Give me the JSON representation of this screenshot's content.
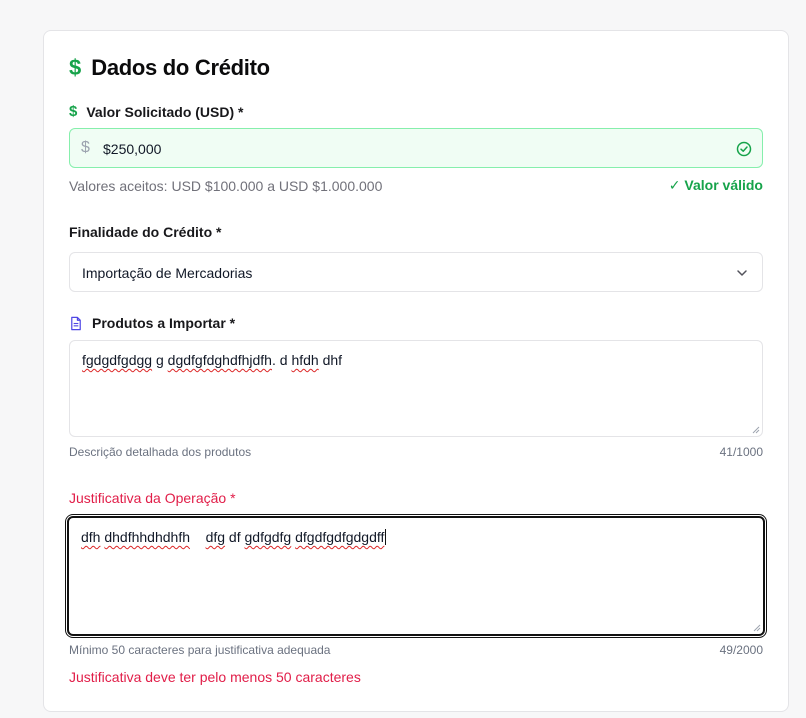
{
  "section": {
    "title": "Dados do Crédito"
  },
  "amount": {
    "label": "Valor Solicitado (USD) *",
    "prefix": "$",
    "value": "$250,000",
    "range_hint": "Valores aceitos: USD $100.000 a USD $1.000.000",
    "valid_message": "✓ Valor válido"
  },
  "purpose": {
    "label": "Finalidade do Crédito *",
    "selected": "Importação de Mercadorias"
  },
  "products": {
    "label": "Produtos a Importar *",
    "value": "fgdgdfgdgg g dgdfgfdghdfhjdfh. d hfdh dhf",
    "hint": "Descrição detalhada dos produtos",
    "count": "41/1000"
  },
  "justification": {
    "label": "Justificativa da Operação *",
    "value": "dfh dhdfhhdhdhfh    dfg df gdfgdfg dfgdfgdfgdgdff",
    "hint": "Mínimo 50 caracteres para justificativa adequada",
    "count": "49/2000",
    "error": "Justificativa deve ter pelo menos 50 caracteres"
  },
  "colors": {
    "accent_green": "#16a34a",
    "error_red": "#e11d48",
    "valid_border": "#86efac"
  },
  "icons": {
    "title_icon": "dollar-icon",
    "amount_icon": "dollar-icon",
    "valid_icon": "check-circle-icon",
    "select_icon": "chevron-down-icon",
    "products_icon": "document-icon"
  }
}
